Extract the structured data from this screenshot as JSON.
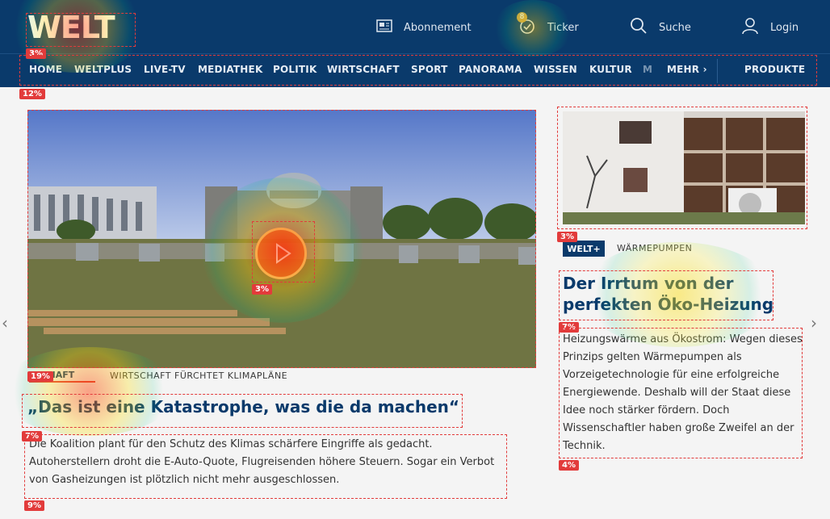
{
  "header": {
    "logo": "WELT",
    "links": [
      {
        "label": "Abonnement",
        "icon": "newspaper-icon"
      },
      {
        "label": "Ticker",
        "icon": "clock-icon",
        "badge": "8"
      },
      {
        "label": "Suche",
        "icon": "search-icon"
      },
      {
        "label": "Login",
        "icon": "user-icon"
      }
    ]
  },
  "nav": {
    "items": [
      "HOME",
      "WELTPLUS",
      "LIVE-TV",
      "MEDIATHEK",
      "POLITIK",
      "WIRTSCHAFT",
      "SPORT",
      "PANORAMA",
      "WISSEN",
      "KULTUR",
      "M"
    ],
    "more": "MEHR ›",
    "products": "PRODUKTE"
  },
  "main_article": {
    "kicker": "TSCHAFT",
    "topic": "WIRTSCHAFT FÜRCHTET KLIMAPLÄNE",
    "headline": "„Das ist eine Katastrophe, was die da machen“",
    "teaser": "Die Koalition plant für den Schutz des Klimas schärfere Eingriffe als gedacht. Autoherstellern droht die E-Auto-Quote, Flugreisenden höhere Steuern. Sogar ein Verbot von Gasheizungen ist plötzlich nicht mehr ausgeschlossen."
  },
  "side_article": {
    "badge": "WELT+",
    "topic": "WÄRMEPUMPEN",
    "headline": "Der Irrtum von der perfekten Öko-Heizung",
    "teaser": "Heizungswärme aus Ökostrom: Wegen dieses Prinzips gelten Wärmepumpen als Vorzeigetechnologie für eine erfolgreiche Energiewende. Deshalb will der Staat diese Idee noch stärker fördern. Doch Wissenschaftler haben große Zweifel an der Technik."
  },
  "heatmap_labels": {
    "logo": "3%",
    "nav": "12%",
    "play": "3%",
    "kicker": "19%",
    "headline_left": "7%",
    "teaser_left": "9%",
    "side_image": "3%",
    "headline_right": "7%",
    "teaser_right": "4%"
  },
  "colors": {
    "brand": "#0a3a6b",
    "accent": "#e23b3b"
  }
}
